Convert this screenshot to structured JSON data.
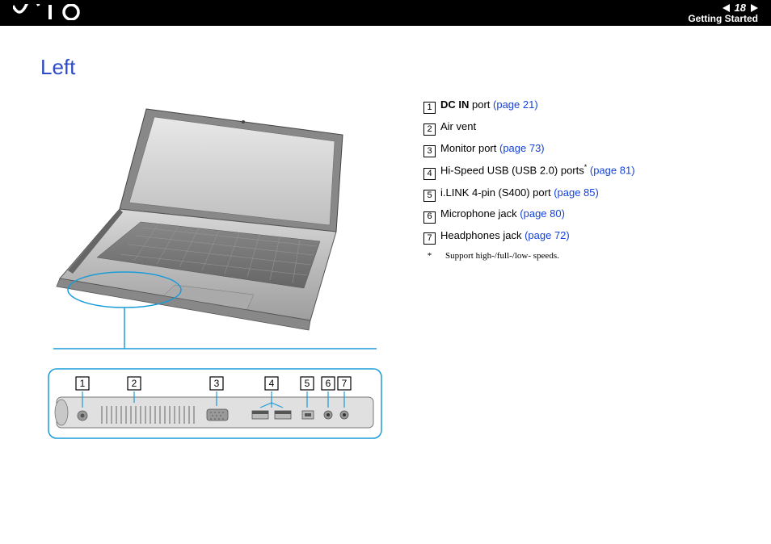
{
  "header": {
    "logo_text": "VAIO",
    "page_number": "18",
    "section": "Getting Started"
  },
  "section_title": "Left",
  "items": [
    {
      "num": "1",
      "bold": "DC IN",
      "rest": " port ",
      "link": "(page 21)"
    },
    {
      "num": "2",
      "bold": "",
      "rest": "Air vent",
      "link": ""
    },
    {
      "num": "3",
      "bold": "",
      "rest": "Monitor port ",
      "link": "(page 73)"
    },
    {
      "num": "4",
      "bold": "",
      "rest": "Hi-Speed USB (USB 2.0) ports",
      "sup": "*",
      "rest2": " ",
      "link": "(page 81)"
    },
    {
      "num": "5",
      "bold": "",
      "rest": "i.LINK 4-pin (S400) port ",
      "link": "(page 85)"
    },
    {
      "num": "6",
      "bold": "",
      "rest": "Microphone jack ",
      "link": "(page 80)"
    },
    {
      "num": "7",
      "bold": "",
      "rest": "Headphones jack ",
      "link": "(page 72)"
    }
  ],
  "footnote": {
    "star": "*",
    "text": "Support high-/full-/low- speeds."
  },
  "callout_labels": [
    "1",
    "2",
    "3",
    "4",
    "5",
    "6",
    "7"
  ]
}
